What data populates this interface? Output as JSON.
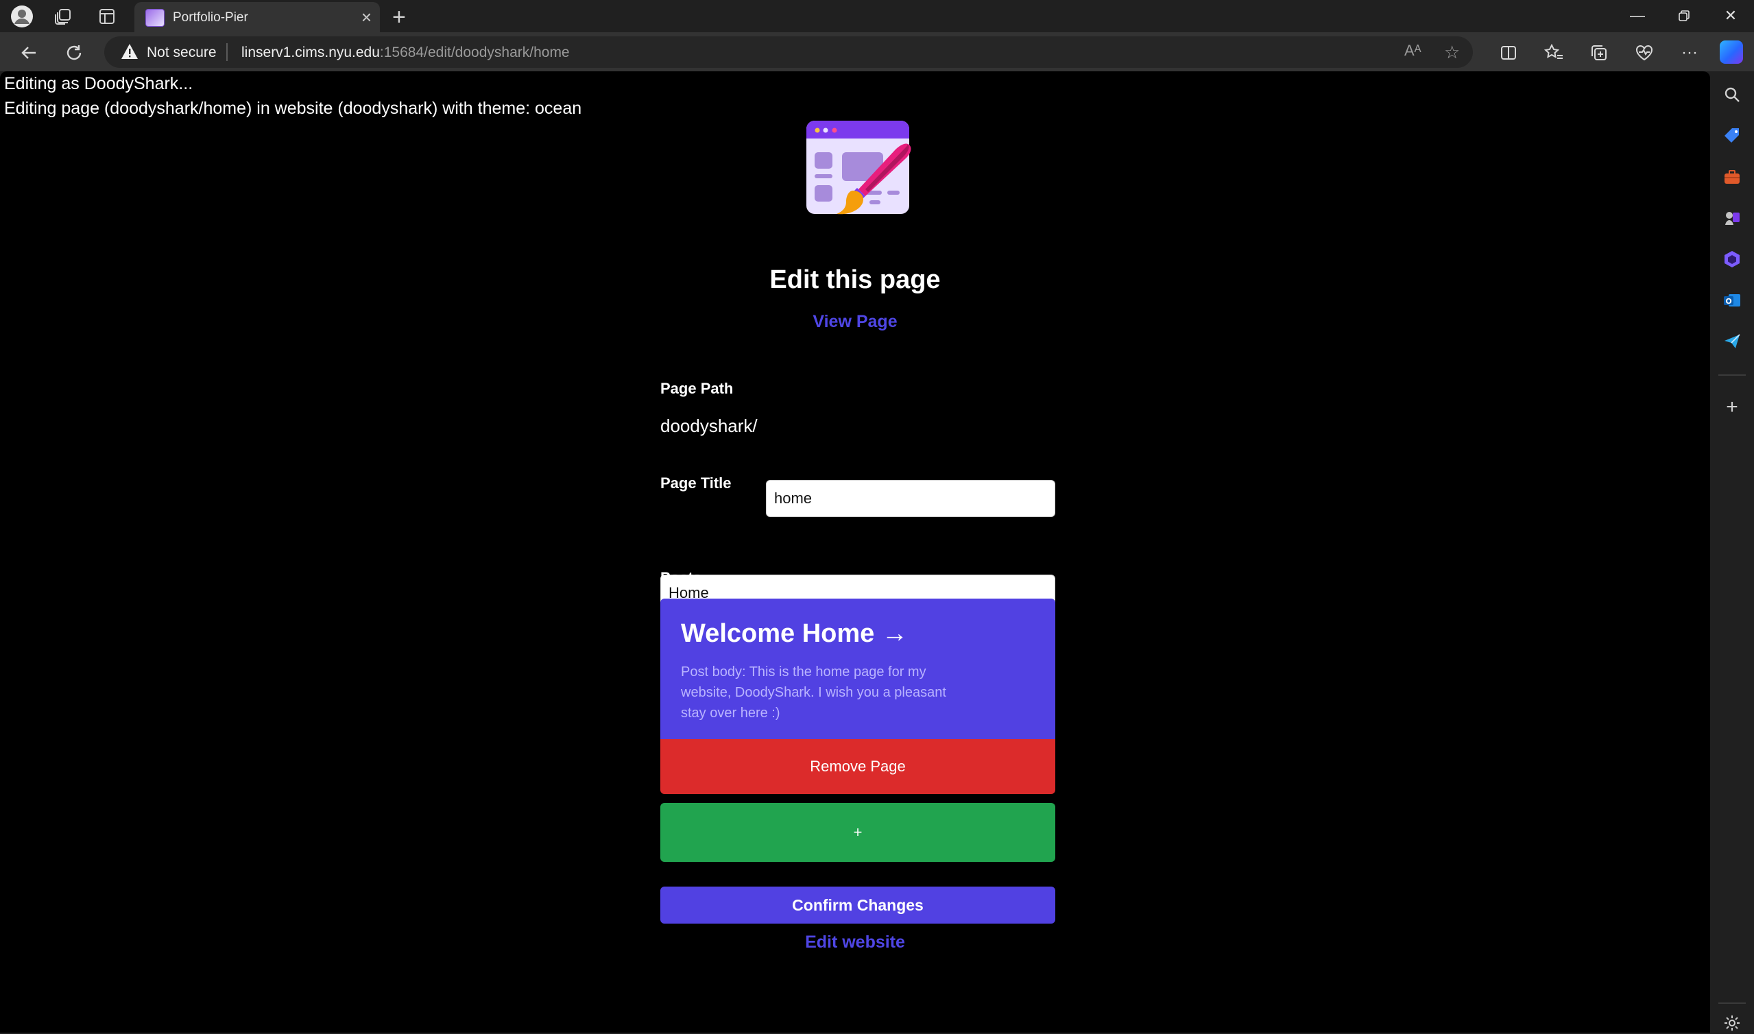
{
  "browser": {
    "tab_title": "Portfolio-Pier",
    "not_secure": "Not secure",
    "url_host": "linserv1.cims.nyu.edu",
    "url_rest": ":15684/edit/doodyshark/home"
  },
  "page": {
    "status_user": "Editing as DoodyShark...",
    "status_page": "Editing page (doodyshark/home) in website (doodyshark) with theme: ocean",
    "heading": "Edit this page",
    "view_page": "View Page",
    "path_label": "Page Path",
    "path_prefix": "doodyshark/",
    "path_value": "home",
    "title_label": "Page Title",
    "title_value": "Home",
    "posts_label": "Posts",
    "post": {
      "title": "Welcome Home →",
      "body": "Post body: This is the home page for my website, DoodyShark. I wish you a pleasant stay over here :)"
    },
    "remove_label": "Remove Page",
    "add_label": "+",
    "confirm_label": "Confirm Changes",
    "edit_website": "Edit website"
  },
  "colors": {
    "accent": "#5141e2",
    "danger": "#dc2b2b",
    "success": "#21a44f",
    "background": "#000000"
  }
}
